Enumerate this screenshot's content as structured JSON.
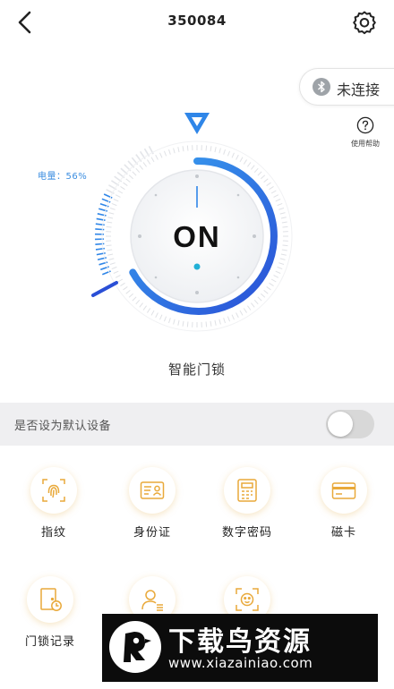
{
  "header": {
    "title": "350084"
  },
  "connection": {
    "label": "未连接"
  },
  "help": {
    "label": "使用帮助"
  },
  "gauge": {
    "status": "ON",
    "battery_label": "电量：56%",
    "battery_percent": 56,
    "caption": "智能门锁"
  },
  "default_device": {
    "label": "是否设为默认设备",
    "enabled": false
  },
  "functions": [
    {
      "label": "指纹",
      "icon": "fingerprint-icon"
    },
    {
      "label": "身份证",
      "icon": "id-card-icon"
    },
    {
      "label": "数字密码",
      "icon": "keypad-icon"
    },
    {
      "label": "磁卡",
      "icon": "card-icon"
    },
    {
      "label": "门锁记录",
      "icon": "door-record-icon"
    },
    {
      "label": "",
      "icon": "user-list-icon"
    },
    {
      "label": "",
      "icon": "face-icon"
    }
  ],
  "watermark": {
    "title": "下载鸟资源",
    "url": "www.xiazainiao.com"
  },
  "colors": {
    "accent": "#2f86e8",
    "accent_dark": "#2a50d6",
    "icon_gold": "#e9a93a",
    "toggle_off": "#d8d8d8"
  }
}
